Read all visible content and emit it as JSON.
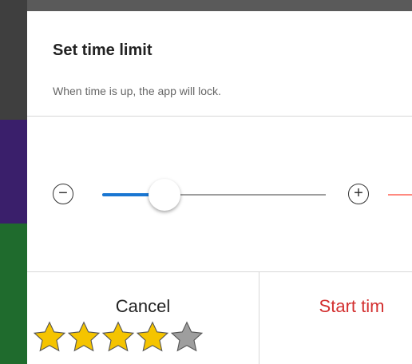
{
  "dialog": {
    "title": "Set time limit",
    "subtitle": "When time is up, the app will lock.",
    "cancel_label": "Cancel",
    "start_label": "Start tim"
  },
  "slider": {
    "minus_icon": "minus-circle-icon",
    "plus_icon": "plus-circle-icon",
    "level_fraction": 0.28,
    "accent": "#1976d2"
  },
  "rating": {
    "value": 4,
    "max": 5,
    "filled_color": "#f5c400",
    "empty_color": "#9e9e9e"
  },
  "colors": {
    "start_button": "#d32f2f"
  }
}
